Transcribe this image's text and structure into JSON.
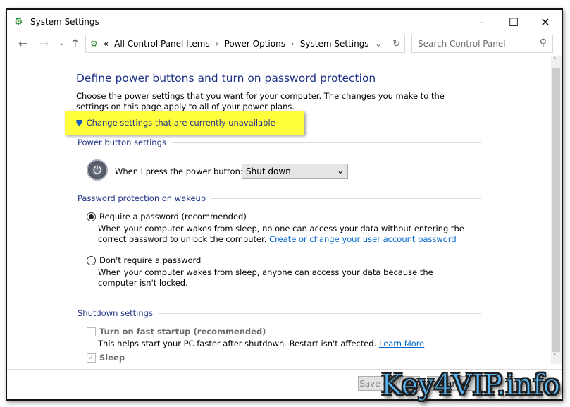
{
  "window": {
    "title": "System Settings",
    "minimize": "–",
    "maximize": "☐",
    "close": "✕"
  },
  "nav": {
    "back": "←",
    "forward": "→",
    "recent": "⌄",
    "up": "↑"
  },
  "address": {
    "prefix": "«",
    "crumbs": [
      "All Control Panel Items",
      "Power Options",
      "System Settings"
    ],
    "sep": "›",
    "dropdown": "⌄",
    "refresh": "↻"
  },
  "search": {
    "placeholder": "Search Control Panel",
    "icon": "⚲"
  },
  "page": {
    "heading": "Define power buttons and turn on password protection",
    "intro": "Choose the power settings that you want for your computer. The changes you make to the settings on this page apply to all of your power plans.",
    "change_link": "Change settings that are currently unavailable",
    "power_section": "Power button settings",
    "power_label": "When I press the power button:",
    "power_value": "Shut down",
    "password_section": "Password protection on wakeup",
    "require_label": "Require a password (recommended)",
    "require_desc": "When your computer wakes from sleep, no one can access your data without entering the correct password to unlock the computer.",
    "require_link": "Create or change your user account password",
    "norequire_label": "Don't require a password",
    "norequire_desc": "When your computer wakes from sleep, anyone can access your data because the computer isn't locked.",
    "shutdown_section": "Shutdown settings",
    "fast_label": "Turn on fast startup (recommended)",
    "fast_desc": "This helps start your PC faster after shutdown. Restart isn't affected.",
    "fast_link": "Learn More",
    "sleep_label": "Sleep"
  },
  "footer": {
    "save": "Save changes",
    "cancel": "Cancel"
  },
  "watermark": "Key4VIP.info",
  "colors": {
    "heading": "#1e3287",
    "highlight": "#ffff3b",
    "link": "#0066cc"
  }
}
